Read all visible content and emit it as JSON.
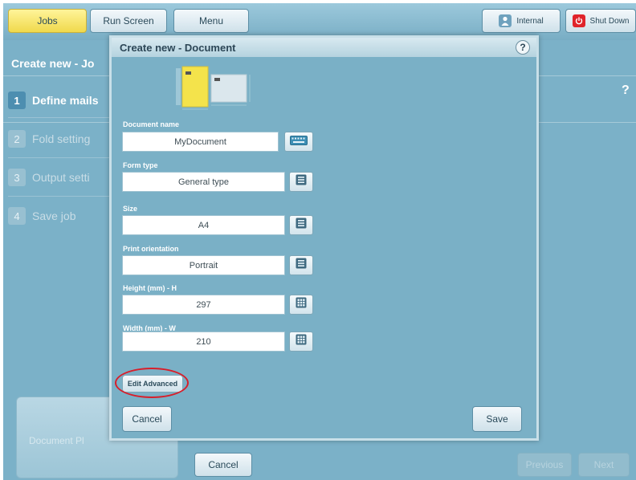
{
  "topbar": {
    "tabs": [
      {
        "label": "Jobs",
        "active": true
      },
      {
        "label": "Run Screen",
        "active": false
      },
      {
        "label": "Menu",
        "active": false
      }
    ],
    "internal_label": "Internal",
    "shutdown_label": "Shut Down"
  },
  "background": {
    "title": "Create new - Jo",
    "help": "?",
    "steps": [
      {
        "num": "1",
        "label": "Define mails"
      },
      {
        "num": "2",
        "label": "Fold setting"
      },
      {
        "num": "3",
        "label": "Output setti"
      },
      {
        "num": "4",
        "label": "Save job"
      }
    ],
    "preview_label": "Document Pl",
    "cancel_label": "Cancel",
    "previous_label": "Previous",
    "next_label": "Next"
  },
  "modal": {
    "title": "Create new - Document",
    "help": "?",
    "fields": [
      {
        "label": "Document name",
        "value": "MyDocument",
        "button": "keyboard-icon"
      },
      {
        "label": "Form type",
        "value": "General type",
        "button": "list-icon"
      },
      {
        "label": "Size",
        "value": "A4",
        "button": "list-icon"
      },
      {
        "label": "Print orientation",
        "value": "Portrait",
        "button": "list-icon"
      },
      {
        "label": "Height (mm) - H",
        "value": "297",
        "button": "numpad-icon"
      },
      {
        "label": "Width (mm) - W",
        "value": "210",
        "button": "numpad-icon"
      }
    ],
    "edit_advanced_label": "Edit Advanced",
    "cancel_label": "Cancel",
    "save_label": "Save"
  },
  "colors": {
    "background": "#7bb1c8",
    "active_tab": "#f0d94c",
    "doc_yellow": "#f4e34b",
    "highlight_ring": "#d81e2a",
    "shutdown_red": "#e0242b"
  }
}
